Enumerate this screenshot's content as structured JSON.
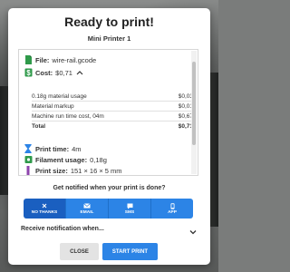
{
  "dialog": {
    "title": "Ready to print!",
    "printer_name": "Mini Printer 1"
  },
  "summary": {
    "file_label": "File:",
    "file_value": "wire-rail.gcode",
    "cost_label": "Cost:",
    "cost_value": "$0,71",
    "cost_rows": [
      {
        "label": "0.18g material usage",
        "value": "$0,03"
      },
      {
        "label": "Material markup",
        "value": "$0,01"
      },
      {
        "label": "Machine run time cost, 04m",
        "value": "$0,67"
      },
      {
        "label": "Total",
        "value": "$0,71"
      }
    ],
    "print_time_label": "Print time:",
    "print_time_value": "4m",
    "filament_label": "Filament usage:",
    "filament_value": "0,18g",
    "print_size_label": "Print size:",
    "print_size_value": "151 × 16 × 5 mm"
  },
  "notification": {
    "question": "Get notified when your print is done?",
    "channels": [
      {
        "label": "NO THANKS",
        "icon": "close-icon",
        "selected": true
      },
      {
        "label": "EMAIL",
        "icon": "email-icon",
        "selected": false
      },
      {
        "label": "SMS",
        "icon": "sms-icon",
        "selected": false
      },
      {
        "label": "APP",
        "icon": "phone-icon",
        "selected": false
      }
    ],
    "receive_label": "Receive notification when..."
  },
  "actions": {
    "close_label": "CLOSE",
    "start_label": "START PRINT"
  },
  "colors": {
    "accent": "#2c84e6",
    "accent_dark": "#1a5fc0",
    "icon_green": "#2f9a4a",
    "icon_blue": "#2c84e6",
    "icon_purple": "#8e44ad"
  }
}
